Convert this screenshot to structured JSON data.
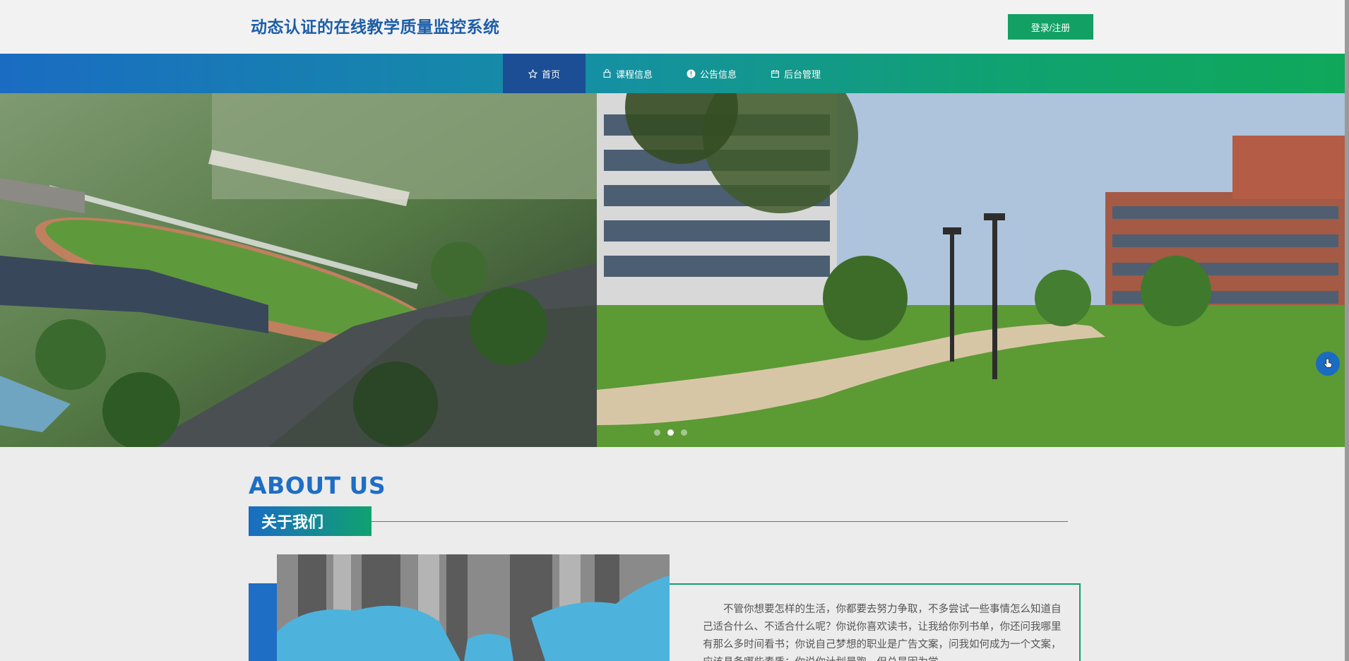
{
  "header": {
    "title": "动态认证的在线教学质量监控系统",
    "login_label": "登录/注册"
  },
  "nav": {
    "items": [
      {
        "label": "首页",
        "icon": "star-icon",
        "active": true
      },
      {
        "label": "课程信息",
        "icon": "bag-icon",
        "active": false
      },
      {
        "label": "公告信息",
        "icon": "info-icon",
        "active": false
      },
      {
        "label": "后台管理",
        "icon": "calendar-icon",
        "active": false
      }
    ]
  },
  "banner": {
    "slide_count": 3,
    "active_index": 1
  },
  "about": {
    "title_en": "ABOUT US",
    "title_zh": "关于我们",
    "text": "不管你想要怎样的生活，你都要去努力争取，不多尝试一些事情怎么知道自己适合什么、不适合什么呢？你说你喜欢读书，让我给你列书单，你还问我哪里有那么多时间看书；你说自己梦想的职业是广告文案，问我如何成为一个文案，应该具备哪些素质；你说你计划晨跑，但总是因为学"
  },
  "colors": {
    "brand_blue": "#1d6ec4",
    "brand_green": "#10a270",
    "nav_active": "#1b4e94"
  }
}
